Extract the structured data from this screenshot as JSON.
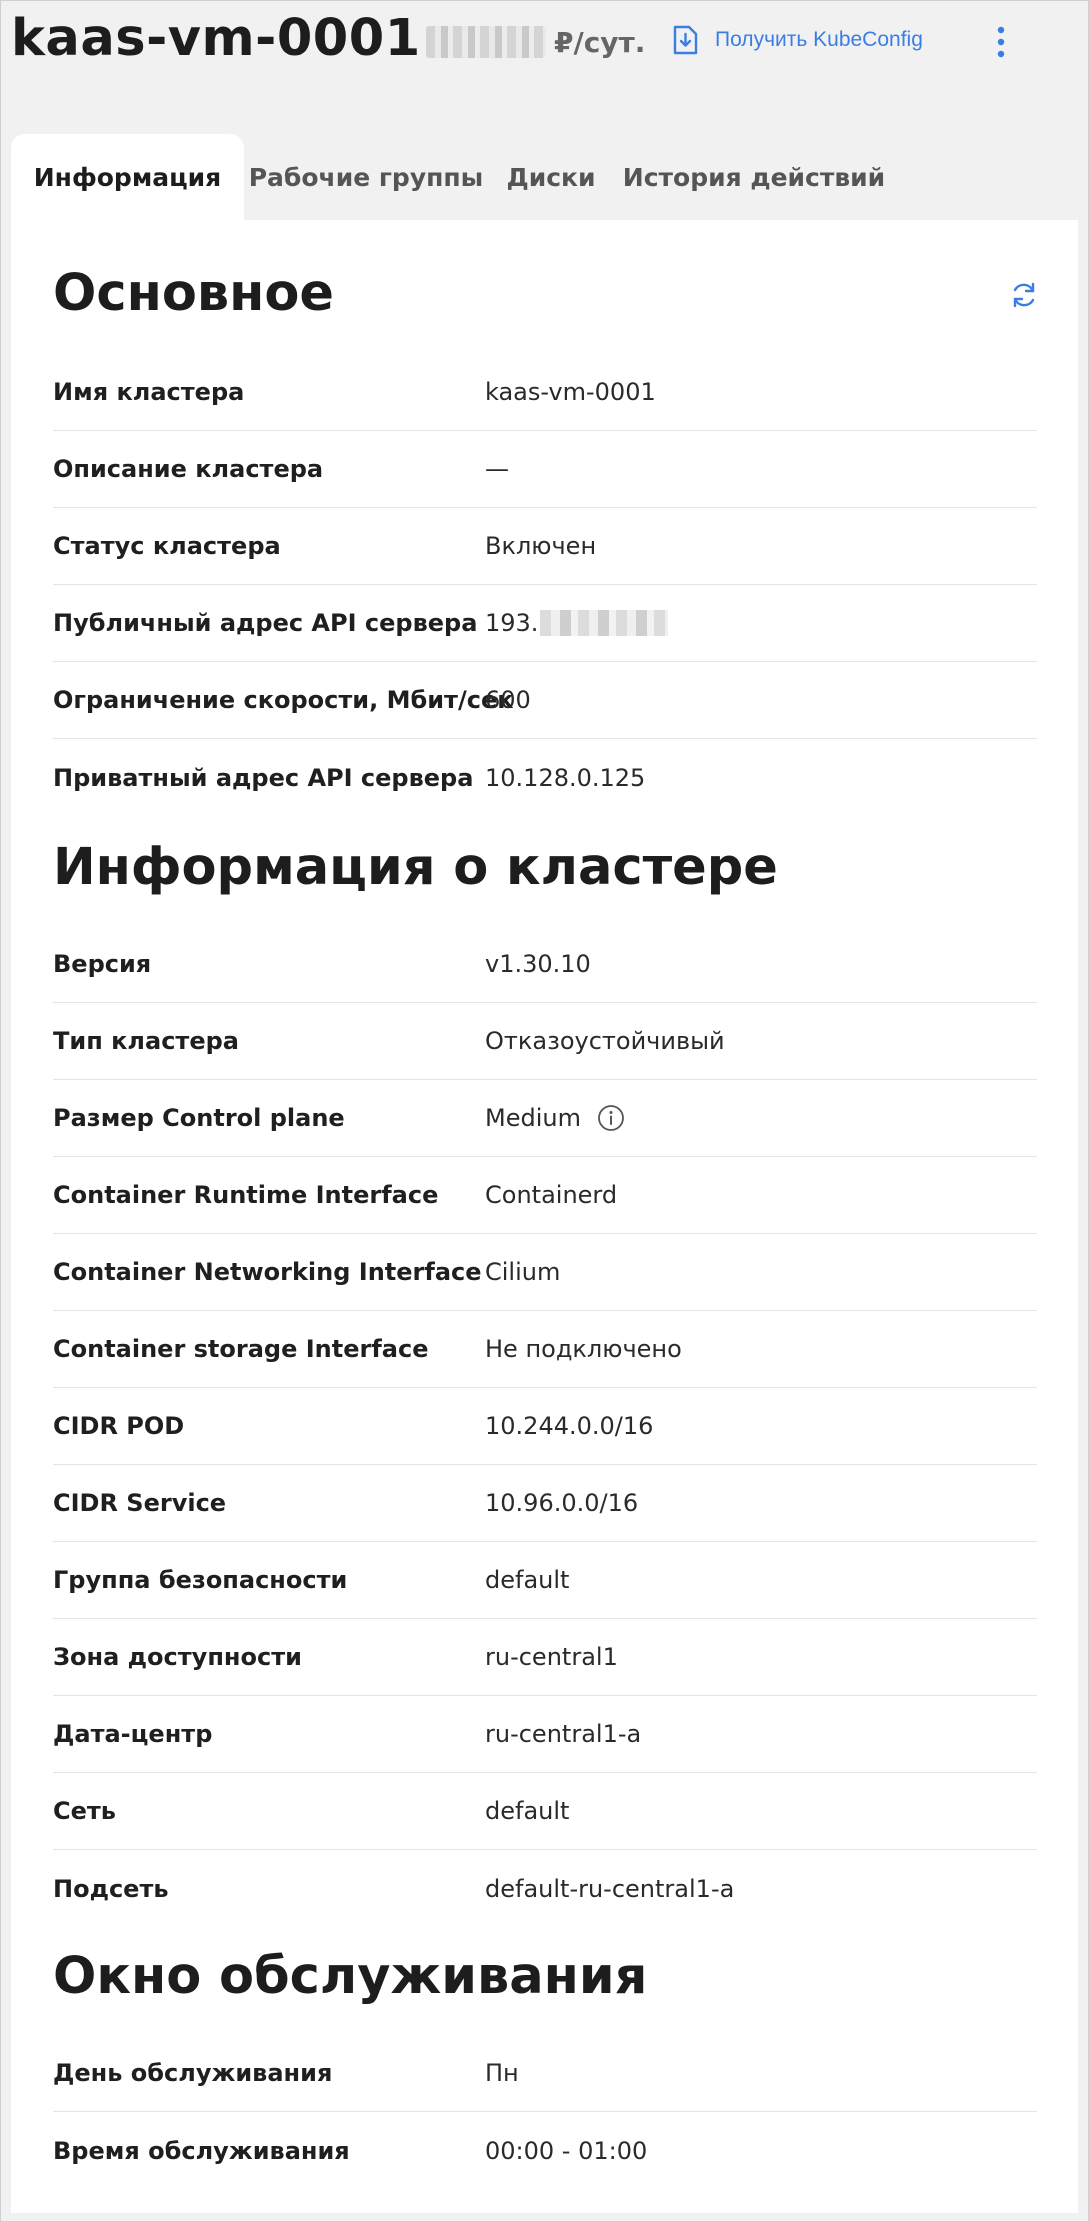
{
  "header": {
    "title": "kaas-vm-0001",
    "price_unit": "₽/сут.",
    "kubeconfig_label": "Получить KubeConfig"
  },
  "tabs": [
    {
      "label": "Информация",
      "active": true
    },
    {
      "label": "Рабочие группы",
      "active": false
    },
    {
      "label": "Диски",
      "active": false
    },
    {
      "label": "История действий",
      "active": false
    }
  ],
  "sections": {
    "basic": {
      "title": "Основное",
      "rows": [
        {
          "label": "Имя кластера",
          "value": "kaas-vm-0001"
        },
        {
          "label": "Описание кластера",
          "value": "—"
        },
        {
          "label": "Статус кластера",
          "value": "Включен"
        },
        {
          "label": "Публичный адрес API сервера",
          "value": "193."
        },
        {
          "label": "Ограничение скорости, Мбит/сек",
          "value": "600"
        },
        {
          "label": "Приватный адрес API сервера",
          "value": "10.128.0.125"
        }
      ]
    },
    "cluster_info": {
      "title": "Информация о кластере",
      "rows": [
        {
          "label": "Версия",
          "value": "v1.30.10"
        },
        {
          "label": "Тип кластера",
          "value": "Отказоустойчивый"
        },
        {
          "label": "Размер Control plane",
          "value": "Medium"
        },
        {
          "label": "Container Runtime Interface",
          "value": "Containerd"
        },
        {
          "label": "Container Networking Interface",
          "value": "Cilium"
        },
        {
          "label": "Container storage Interface",
          "value": "Не подключено"
        },
        {
          "label": "CIDR POD",
          "value": "10.244.0.0/16"
        },
        {
          "label": "CIDR Service",
          "value": "10.96.0.0/16"
        },
        {
          "label": "Группа безопасности",
          "value": "default"
        },
        {
          "label": "Зона доступности",
          "value": "ru-central1"
        },
        {
          "label": "Дата-центр",
          "value": "ru-central1-a"
        },
        {
          "label": "Сеть",
          "value": "default"
        },
        {
          "label": "Подсеть",
          "value": "default-ru-central1-a"
        }
      ]
    },
    "maintenance": {
      "title": "Окно обслуживания",
      "rows": [
        {
          "label": "День обслуживания",
          "value": "Пн"
        },
        {
          "label": "Время обслуживания",
          "value": "00:00 - 01:00"
        }
      ]
    }
  },
  "colors": {
    "accent": "#3b7ee3",
    "divider": "#e5e5e5",
    "background": "#f1f1f1"
  },
  "icons": [
    "download-icon",
    "kebab-menu-icon",
    "refresh-icon",
    "info-icon"
  ]
}
